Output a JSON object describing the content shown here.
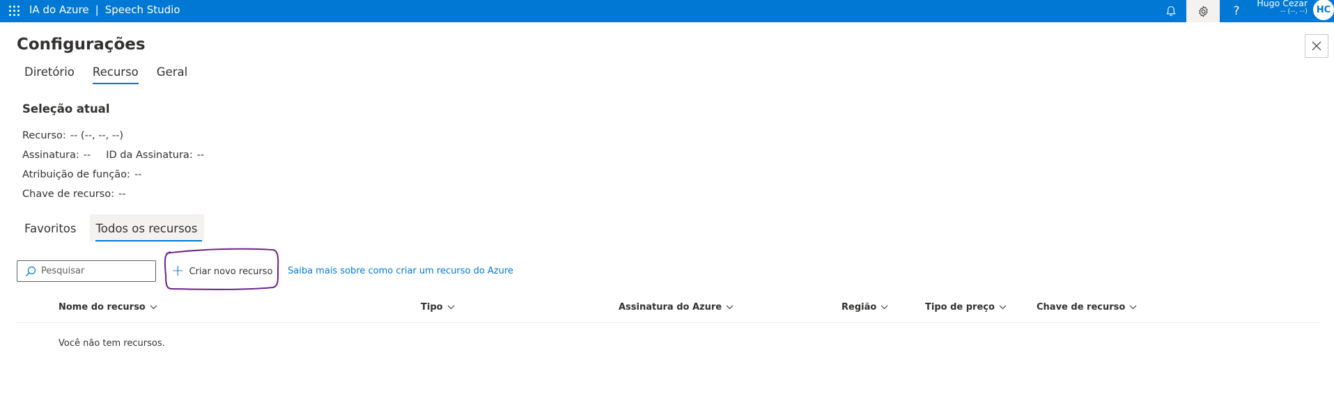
{
  "topbar": {
    "app_name": "IA do Azure",
    "separator": "|",
    "product": "Speech Studio",
    "icons": [
      "waffle-icon",
      "bell-icon",
      "gear-icon",
      "help-icon"
    ],
    "help_glyph": "?",
    "user_name": "Hugo Cezar",
    "user_sub": "-- (--, --)",
    "avatar_initials": "HC",
    "bg_color": "#0078d4"
  },
  "page": {
    "title": "Configurações"
  },
  "tabs": [
    {
      "label": "Diretório",
      "active": false
    },
    {
      "label": "Recurso",
      "active": true
    },
    {
      "label": "Geral",
      "active": false
    }
  ],
  "selection": {
    "title": "Seleção atual",
    "resource_label": "Recurso:",
    "resource_value": "-- (--, --, --)",
    "subscription_label": "Assinatura:",
    "subscription_value": "--",
    "subscription_id_label": "ID da Assinatura:",
    "subscription_id_value": "--",
    "role_label": "Atribuição de função:",
    "role_value": "--",
    "key_label": "Chave de recurso:",
    "key_value": "--"
  },
  "resource_tabs": [
    {
      "label": "Favoritos",
      "active": false
    },
    {
      "label": "Todos os recursos",
      "active": true
    }
  ],
  "toolbar": {
    "search_placeholder": "Pesquisar",
    "create_label": "Criar novo recurso",
    "learn_more": "Saiba mais sobre como criar um recurso do Azure"
  },
  "table": {
    "columns": [
      "Nome do recurso",
      "Tipo",
      "Assinatura do Azure",
      "Região",
      "Tipo de preço",
      "Chave de recurso"
    ],
    "empty_message": "Você não tem recursos."
  },
  "colors": {
    "accent": "#0078d4",
    "annotation": "#6b1f8a"
  }
}
